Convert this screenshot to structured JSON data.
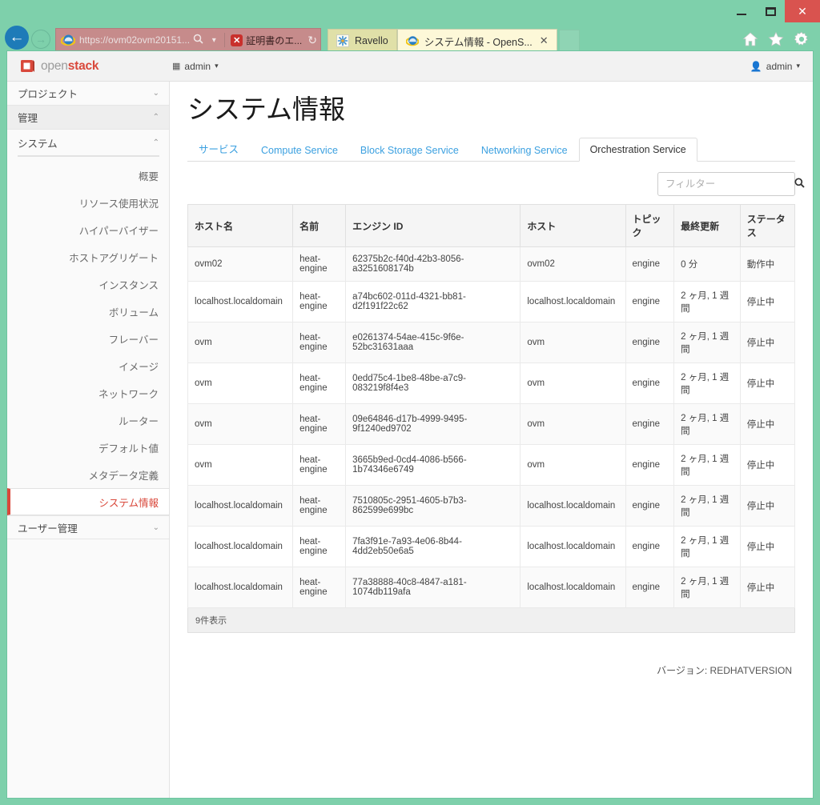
{
  "browser": {
    "window_controls": {
      "minimize": "–",
      "maximize": "❐",
      "close": "✕"
    },
    "nav": {
      "back": "←",
      "forward": "→"
    },
    "address": {
      "url": "https://ovm02ovm20151...",
      "search_icon": "search-icon",
      "dropdown_icon": "▾",
      "cert_error_label": "証明書のエ...",
      "cert_error_badge": "✕",
      "refresh_icon": "↻"
    },
    "tabs": [
      {
        "label": "Ravello",
        "active": false,
        "closable": false
      },
      {
        "label": "システム情報 - OpenS...",
        "active": true,
        "closable": true,
        "close_label": "✕"
      }
    ],
    "toolbar_icons": [
      {
        "name": "home-icon",
        "glyph": "⌂"
      },
      {
        "name": "favorites-star-icon",
        "glyph": "★"
      },
      {
        "name": "settings-gear-icon",
        "glyph": "⚙"
      }
    ]
  },
  "topbar": {
    "logo_open": "open",
    "logo_stack": "stack",
    "project_label": "admin",
    "project_caret": "▾",
    "user_label": "admin",
    "user_caret": "▾"
  },
  "sidebar": {
    "groups": [
      {
        "label": "プロジェクト",
        "caret": "⌄",
        "active": false
      },
      {
        "label": "管理",
        "caret": "⌃",
        "active": true
      }
    ],
    "section": {
      "label": "システム",
      "caret": "⌃"
    },
    "items": [
      {
        "label": "概要",
        "current": false
      },
      {
        "label": "リソース使用状況",
        "current": false
      },
      {
        "label": "ハイパーバイザー",
        "current": false
      },
      {
        "label": "ホストアグリゲート",
        "current": false
      },
      {
        "label": "インスタンス",
        "current": false
      },
      {
        "label": "ボリューム",
        "current": false
      },
      {
        "label": "フレーバー",
        "current": false
      },
      {
        "label": "イメージ",
        "current": false
      },
      {
        "label": "ネットワーク",
        "current": false
      },
      {
        "label": "ルーター",
        "current": false
      },
      {
        "label": "デフォルト値",
        "current": false
      },
      {
        "label": "メタデータ定義",
        "current": false
      },
      {
        "label": "システム情報",
        "current": true
      }
    ],
    "footer_group": {
      "label": "ユーザー管理",
      "caret": "⌄"
    }
  },
  "main": {
    "page_title": "システム情報",
    "tabs": [
      {
        "label": "サービス",
        "active": false
      },
      {
        "label": "Compute Service",
        "active": false
      },
      {
        "label": "Block Storage Service",
        "active": false
      },
      {
        "label": "Networking Service",
        "active": false
      },
      {
        "label": "Orchestration Service",
        "active": true
      }
    ],
    "filter": {
      "placeholder": "フィルター",
      "value": "",
      "icon": "search-icon"
    },
    "table": {
      "columns": [
        "ホスト名",
        "名前",
        "エンジン ID",
        "ホスト",
        "トピック",
        "最終更新",
        "ステータス"
      ],
      "rows": [
        {
          "hostname": "ovm02",
          "name": "heat-engine",
          "engine_id": "62375b2c-f40d-42b3-8056-a3251608174b",
          "host": "ovm02",
          "topic": "engine",
          "updated": "0 分",
          "status": "動作中"
        },
        {
          "hostname": "localhost.localdomain",
          "name": "heat-engine",
          "engine_id": "a74bc602-011d-4321-bb81-d2f191f22c62",
          "host": "localhost.localdomain",
          "topic": "engine",
          "updated": "2 ヶ月, 1 週間",
          "status": "停止中"
        },
        {
          "hostname": "ovm",
          "name": "heat-engine",
          "engine_id": "e0261374-54ae-415c-9f6e-52bc31631aaa",
          "host": "ovm",
          "topic": "engine",
          "updated": "2 ヶ月, 1 週間",
          "status": "停止中"
        },
        {
          "hostname": "ovm",
          "name": "heat-engine",
          "engine_id": "0edd75c4-1be8-48be-a7c9-083219f8f4e3",
          "host": "ovm",
          "topic": "engine",
          "updated": "2 ヶ月, 1 週間",
          "status": "停止中"
        },
        {
          "hostname": "ovm",
          "name": "heat-engine",
          "engine_id": "09e64846-d17b-4999-9495-9f1240ed9702",
          "host": "ovm",
          "topic": "engine",
          "updated": "2 ヶ月, 1 週間",
          "status": "停止中"
        },
        {
          "hostname": "ovm",
          "name": "heat-engine",
          "engine_id": "3665b9ed-0cd4-4086-b566-1b74346e6749",
          "host": "ovm",
          "topic": "engine",
          "updated": "2 ヶ月, 1 週間",
          "status": "停止中"
        },
        {
          "hostname": "localhost.localdomain",
          "name": "heat-engine",
          "engine_id": "7510805c-2951-4605-b7b3-862599e699bc",
          "host": "localhost.localdomain",
          "topic": "engine",
          "updated": "2 ヶ月, 1 週間",
          "status": "停止中"
        },
        {
          "hostname": "localhost.localdomain",
          "name": "heat-engine",
          "engine_id": "7fa3f91e-7a93-4e06-8b44-4dd2eb50e6a5",
          "host": "localhost.localdomain",
          "topic": "engine",
          "updated": "2 ヶ月, 1 週間",
          "status": "停止中"
        },
        {
          "hostname": "localhost.localdomain",
          "name": "heat-engine",
          "engine_id": "77a38888-40c8-4847-a181-1074db119afa",
          "host": "localhost.localdomain",
          "topic": "engine",
          "updated": "2 ヶ月, 1 週間",
          "status": "停止中"
        }
      ],
      "footer_count": "9件表示"
    },
    "version_text": "バージョン: REDHATVERSION"
  },
  "colors": {
    "window_chrome": "#7ed0ab",
    "accent_red": "#d9483b",
    "link_blue": "#3ba0e0",
    "close_button": "#d9534f",
    "address_error": "#c68b8b"
  }
}
